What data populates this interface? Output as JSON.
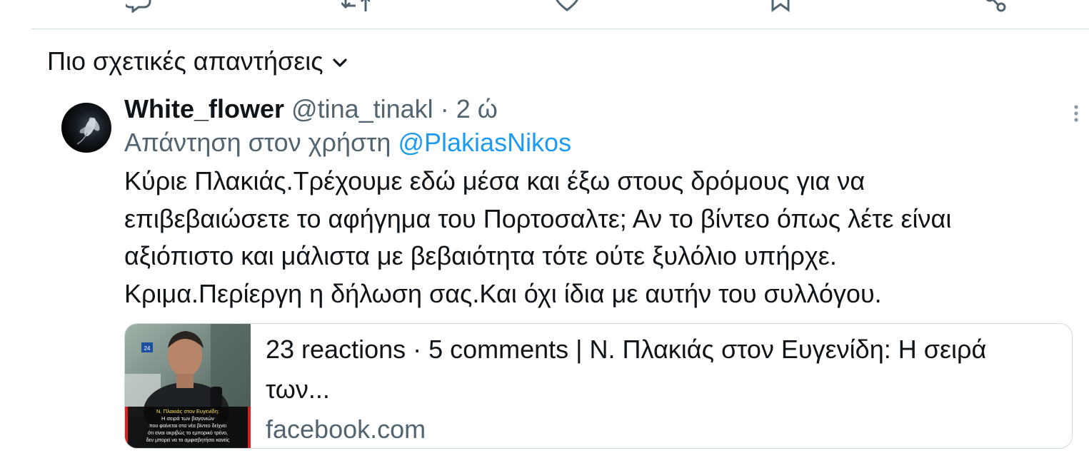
{
  "sort": {
    "label": "Πιο σχετικές απαντήσεις"
  },
  "reply": {
    "author_name": "White_flower",
    "author_handle": "@tina_tinakl",
    "separator": "·",
    "time": "2 ώ",
    "replying_prefix": "Απάντηση στον χρήστη",
    "replying_mention": "@PlakiasNikos",
    "text_lines": [
      "Κύριε Πλακιάς.Τρέχουμε εδώ μέσα και έξω στους δρόμους για να",
      "επιβεβαιώσετε το αφήγημα του Πορτοσαλτε; Αν το βίντεο όπως λέτε είναι",
      "αξιόπιστο και μάλιστα με βεβαιότητα τότε ούτε ξυλόλιο υπήρχε.",
      "Κριμα.Περίεργη η δήλωση σας.Και όχι ίδια με αυτήν του συλλόγου."
    ]
  },
  "card": {
    "title_line1": "23 reactions · 5 comments | Ν. Πλακιάς στον Ευγενίδη: Η σειρά",
    "title_line2": "των...",
    "domain": "facebook.com",
    "thumb_caption": [
      "Ν. Πλακιάς στον Ευγενίδη:",
      "Η σειρά των βαγονιών",
      "που φαίνεται στα νέα βίντεο δείχνει",
      "ότι είναι ακριβώς το εμπορικό τρένο,",
      "δεν μπορεί να το αμφισβητήσει κανείς"
    ],
    "thumb_badge": "24"
  },
  "icons": {
    "reply": "reply-icon",
    "retweet": "retweet-icon",
    "like": "like-icon",
    "bookmark": "bookmark-icon",
    "share": "share-icon",
    "chevron": "chevron-down-icon",
    "more": "more-icon"
  },
  "colors": {
    "text": "#0f1419",
    "secondary": "#536471",
    "link": "#1d9bf0",
    "divider": "#cfd9de"
  }
}
